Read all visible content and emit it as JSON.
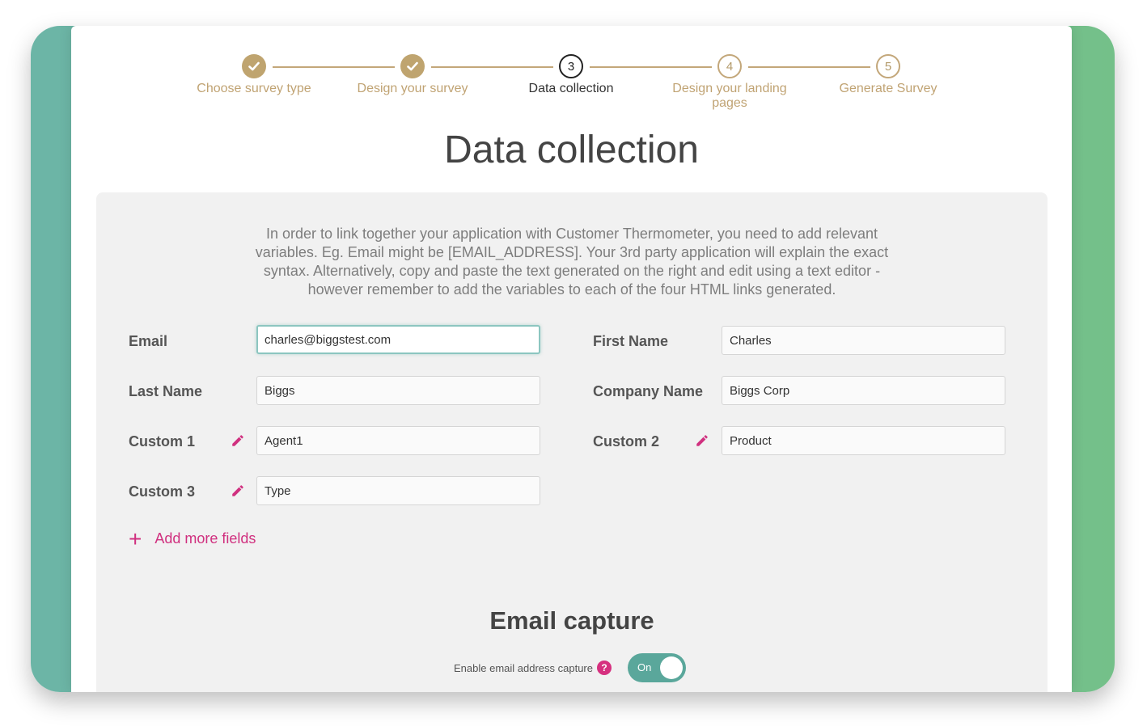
{
  "stepper": {
    "steps": [
      {
        "label": "Choose survey type",
        "number": "1",
        "state": "done"
      },
      {
        "label": "Design your survey",
        "number": "2",
        "state": "done"
      },
      {
        "label": "Data collection",
        "number": "3",
        "state": "current"
      },
      {
        "label": "Design your landing pages",
        "number": "4",
        "state": "todo"
      },
      {
        "label": "Generate Survey",
        "number": "5",
        "state": "todo"
      }
    ]
  },
  "page_title": "Data collection",
  "intro_text": "In order to link together your application with Customer Thermometer, you need to add relevant variables. Eg. Email might be [EMAIL_ADDRESS]. Your 3rd party application will explain the exact syntax. Alternatively, copy and paste the text generated on the right and edit using a text editor - however remember to add the variables to each of the four HTML links generated.",
  "fields": {
    "email": {
      "label": "Email",
      "value": "charles@biggstest.com"
    },
    "first_name": {
      "label": "First Name",
      "value": "Charles"
    },
    "last_name": {
      "label": "Last Name",
      "value": "Biggs"
    },
    "company_name": {
      "label": "Company Name",
      "value": "Biggs Corp"
    },
    "custom1": {
      "label": "Custom 1",
      "value": "Agent1"
    },
    "custom2": {
      "label": "Custom 2",
      "value": "Product"
    },
    "custom3": {
      "label": "Custom 3",
      "value": "Type"
    }
  },
  "add_more_label": "Add more fields",
  "email_capture": {
    "title": "Email capture",
    "toggle_label": "Enable email address capture",
    "help_glyph": "?",
    "toggle_state": "On"
  },
  "colors": {
    "accent_gold": "#bfa46f",
    "accent_pink": "#d0307f",
    "toggle_teal": "#5aa79b"
  },
  "icons": {
    "done_step": "checkmark-icon",
    "edit": "pencil-icon",
    "add": "plus-icon",
    "help": "help-icon"
  }
}
